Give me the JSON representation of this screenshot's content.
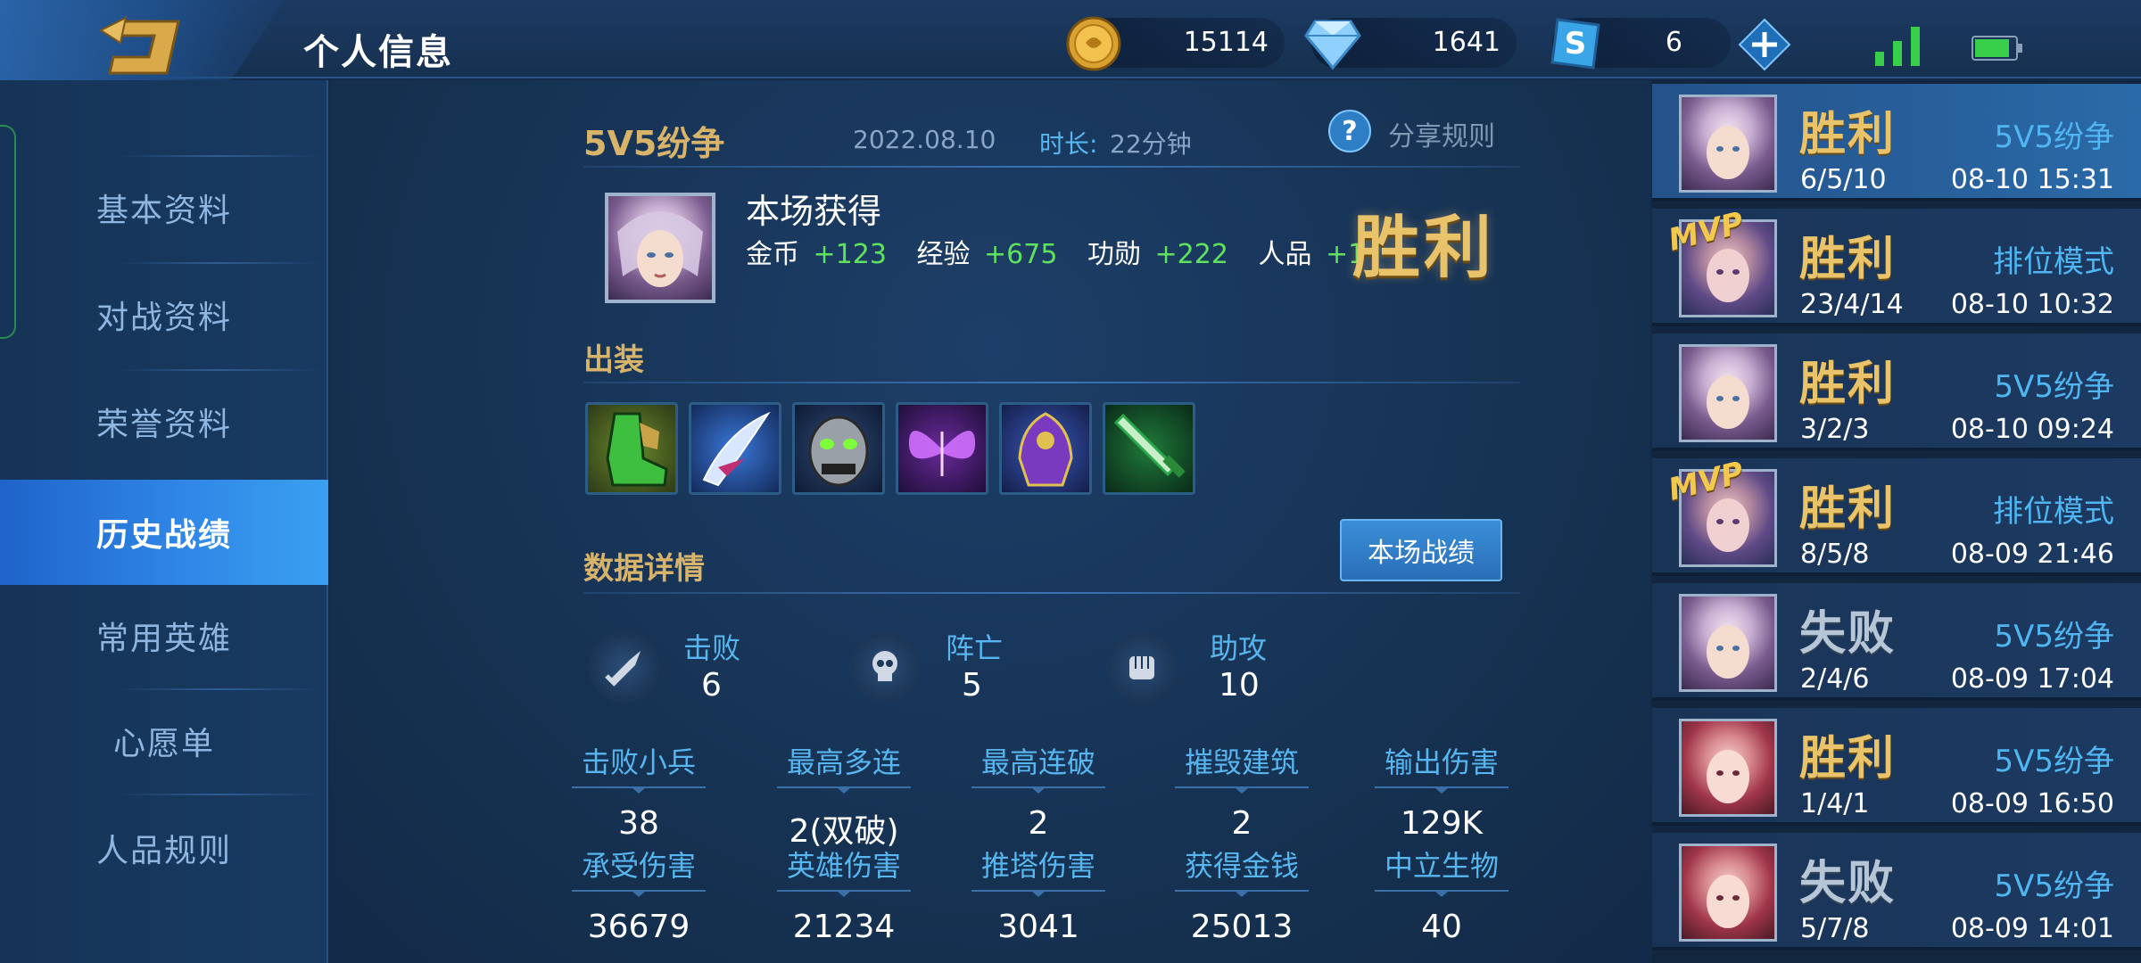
{
  "header": {
    "title": "个人信息",
    "currencies": [
      {
        "name": "gold",
        "value": "15114"
      },
      {
        "name": "diamond",
        "value": "1641"
      },
      {
        "name": "voucher",
        "value": "6"
      }
    ]
  },
  "sidebar": {
    "items": [
      {
        "label": "基本资料",
        "active": false
      },
      {
        "label": "对战资料",
        "active": false
      },
      {
        "label": "荣誉资料",
        "active": false
      },
      {
        "label": "历史战绩",
        "active": true
      },
      {
        "label": "常用英雄",
        "active": false
      },
      {
        "label": "心愿单",
        "active": false
      },
      {
        "label": "人品规则",
        "active": false
      }
    ]
  },
  "match": {
    "mode": "5V5纷争",
    "date": "2022.08.10",
    "duration_label": "时长:",
    "duration": "22分钟",
    "share_rule": "分享规则",
    "reward_title": "本场获得",
    "rewards": [
      {
        "label": "金币",
        "value": "+123"
      },
      {
        "label": "经验",
        "value": "+675"
      },
      {
        "label": "功勋",
        "value": "+222"
      },
      {
        "label": "人品",
        "value": "+1"
      }
    ],
    "result": "胜利",
    "equipment_title": "出装",
    "equipment": [
      "boots-icon",
      "claw-blade-icon",
      "demon-mask-icon",
      "butterfly-icon",
      "cloak-icon",
      "green-sword-icon"
    ],
    "detail_title": "数据详情",
    "detail_button": "本场战绩",
    "kda": [
      {
        "label": "击败",
        "value": "6",
        "icon": "sword-icon"
      },
      {
        "label": "阵亡",
        "value": "5",
        "icon": "skull-icon"
      },
      {
        "label": "助攻",
        "value": "10",
        "icon": "fist-icon"
      }
    ],
    "stats_row1": [
      {
        "label": "击败小兵",
        "value": "38"
      },
      {
        "label": "最高多连",
        "value": "2(双破)"
      },
      {
        "label": "最高连破",
        "value": "2"
      },
      {
        "label": "摧毁建筑",
        "value": "2"
      },
      {
        "label": "输出伤害",
        "value": "129K"
      }
    ],
    "stats_row2": [
      {
        "label": "承受伤害",
        "value": "36679"
      },
      {
        "label": "英雄伤害",
        "value": "21234"
      },
      {
        "label": "推塔伤害",
        "value": "3041"
      },
      {
        "label": "获得金钱",
        "value": "25013"
      },
      {
        "label": "中立生物",
        "value": "40"
      }
    ]
  },
  "history": [
    {
      "result": "胜利",
      "mode": "5V5纷争",
      "kda": "6/5/10",
      "time": "08-10 15:31",
      "mvp": false,
      "win": true
    },
    {
      "result": "胜利",
      "mode": "排位模式",
      "kda": "23/4/14",
      "time": "08-10 10:32",
      "mvp": true,
      "mvp_label": "MVP",
      "win": true
    },
    {
      "result": "胜利",
      "mode": "5V5纷争",
      "kda": "3/2/3",
      "time": "08-10 09:24",
      "mvp": false,
      "win": true
    },
    {
      "result": "胜利",
      "mode": "排位模式",
      "kda": "8/5/8",
      "time": "08-09 21:46",
      "mvp": true,
      "mvp_label": "MVP",
      "win": true
    },
    {
      "result": "失败",
      "mode": "5V5纷争",
      "kda": "2/4/6",
      "time": "08-09 17:04",
      "mvp": false,
      "win": false
    },
    {
      "result": "胜利",
      "mode": "5V5纷争",
      "kda": "1/4/1",
      "time": "08-09 16:50",
      "mvp": false,
      "win": true
    },
    {
      "result": "失败",
      "mode": "5V5纷争",
      "kda": "5/7/8",
      "time": "08-09 14:01",
      "mvp": false,
      "win": false
    }
  ],
  "colors": {
    "gold_title": "#d8b46a",
    "stat_label": "#57b6ef",
    "reward_green": "#5fe35f",
    "active_tab": "#2f86e6"
  }
}
